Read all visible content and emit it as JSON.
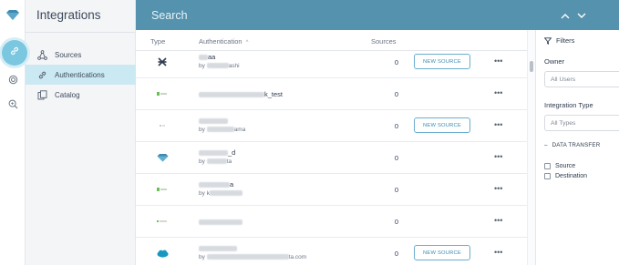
{
  "rail": {
    "logo_icon": "diamond-logo-icon",
    "items": [
      {
        "icon": "link-icon",
        "active": true
      },
      {
        "icon": "target-icon",
        "active": false
      },
      {
        "icon": "search-zoom-icon",
        "active": false
      }
    ]
  },
  "nav": {
    "title": "Integrations",
    "items": [
      {
        "label": "Sources",
        "icon": "sources-icon"
      },
      {
        "label": "Authentications",
        "icon": "link-icon",
        "active": true
      },
      {
        "label": "Catalog",
        "icon": "catalog-icon"
      }
    ]
  },
  "header": {
    "title": "Search",
    "up_icon": "chevron-up-icon",
    "down_icon": "chevron-down-icon"
  },
  "table": {
    "columns": {
      "type": "Type",
      "authentication": "Authentication",
      "sort_indicator": "^",
      "sources": "Sources"
    },
    "rows": [
      {
        "type_icon": "x-brand-icon",
        "name": "aa",
        "by_prefix": "by",
        "by_suffix": "ashi",
        "count": "0",
        "has_new_source": true
      },
      {
        "type_icon": "green-small-icon",
        "name": "k_test",
        "by_prefix": "",
        "by_suffix": "",
        "count": "0",
        "has_new_source": false
      },
      {
        "type_icon": "gray-dot-icon",
        "name": "",
        "by_prefix": "by",
        "by_suffix": "ama",
        "count": "0",
        "has_new_source": true
      },
      {
        "type_icon": "blue-diamond-icon",
        "name": "_d",
        "by_prefix": "by",
        "by_suffix": "ta",
        "count": "0",
        "has_new_source": false
      },
      {
        "type_icon": "green-small-icon",
        "name": "a",
        "by_prefix": "by",
        "by_suffix": "k",
        "count": "0",
        "has_new_source": false
      },
      {
        "type_icon": "green-dot-icon",
        "name": "",
        "by_prefix": "",
        "by_suffix": "",
        "count": "0",
        "has_new_source": false
      },
      {
        "type_icon": "salesforce-cloud-icon",
        "name": "",
        "by_prefix": "by",
        "by_suffix": "ta.com",
        "count": "0",
        "has_new_source": true
      }
    ],
    "new_source_label": "NEW SOURCE",
    "more_label": "•••"
  },
  "filters": {
    "title": "Filters",
    "owner_label": "Owner",
    "owner_value": "All Users",
    "integration_type_label": "Integration Type",
    "integration_type_value": "All Types",
    "section_label": "DATA TRANSFER",
    "section_prefix": "–",
    "checkboxes": [
      "Source",
      "Destination"
    ]
  },
  "colors": {
    "header": "#5492ad",
    "accent": "#3d8bb1",
    "active_nav": "#cbe9f3"
  }
}
